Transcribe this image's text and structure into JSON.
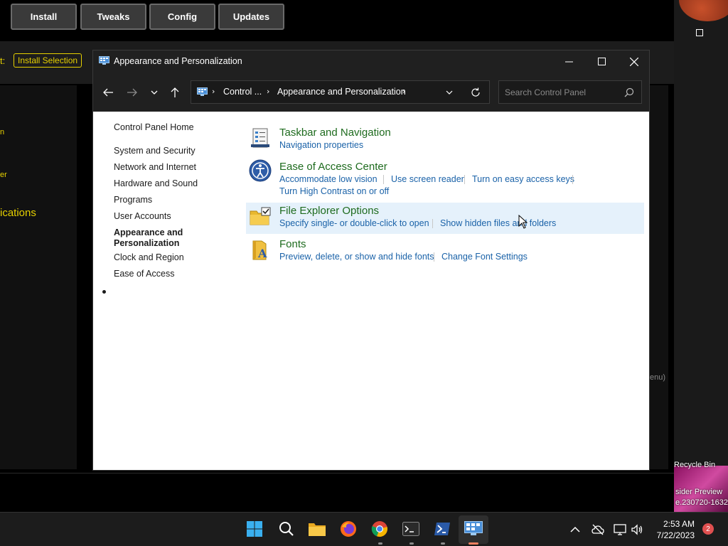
{
  "background_app": {
    "tabs": [
      "Install",
      "Tweaks",
      "Config",
      "Updates"
    ],
    "left_label": "t:",
    "install_selection": "Install Selection",
    "side_fragments": [
      "n",
      "er",
      "ications"
    ],
    "right_fragment": "enu)"
  },
  "desktop": {
    "recycle_bin": "Recycle Bin",
    "watermark_1": "sider Preview",
    "watermark_2": "e.230720-1632"
  },
  "window": {
    "title": "Appearance and Personalization",
    "address": {
      "seg1": "Control ...",
      "seg2": "Appearance and Personalization"
    },
    "search_placeholder": "Search Control Panel"
  },
  "sidebar": {
    "home": "Control Panel Home",
    "items": [
      "System and Security",
      "Network and Internet",
      "Hardware and Sound",
      "Programs",
      "User Accounts",
      "Appearance and Personalization",
      "Clock and Region",
      "Ease of Access"
    ],
    "active_line1": "Appearance and",
    "active_line2": "Personalization"
  },
  "categories": {
    "taskbar": {
      "title": "Taskbar and Navigation",
      "links": [
        "Navigation properties"
      ]
    },
    "ease": {
      "title": "Ease of Access Center",
      "links": [
        "Accommodate low vision",
        "Use screen reader",
        "Turn on easy access keys",
        "Turn High Contrast on or off"
      ]
    },
    "explorer": {
      "title": "File Explorer Options",
      "links": [
        "Specify single- or double-click to open",
        "Show hidden files and folders"
      ]
    },
    "fonts": {
      "title": "Fonts",
      "links": [
        "Preview, delete, or show and hide fonts",
        "Change Font Settings"
      ]
    }
  },
  "taskbar": {
    "time": "2:53 AM",
    "date": "7/22/2023",
    "notifications": "2"
  }
}
